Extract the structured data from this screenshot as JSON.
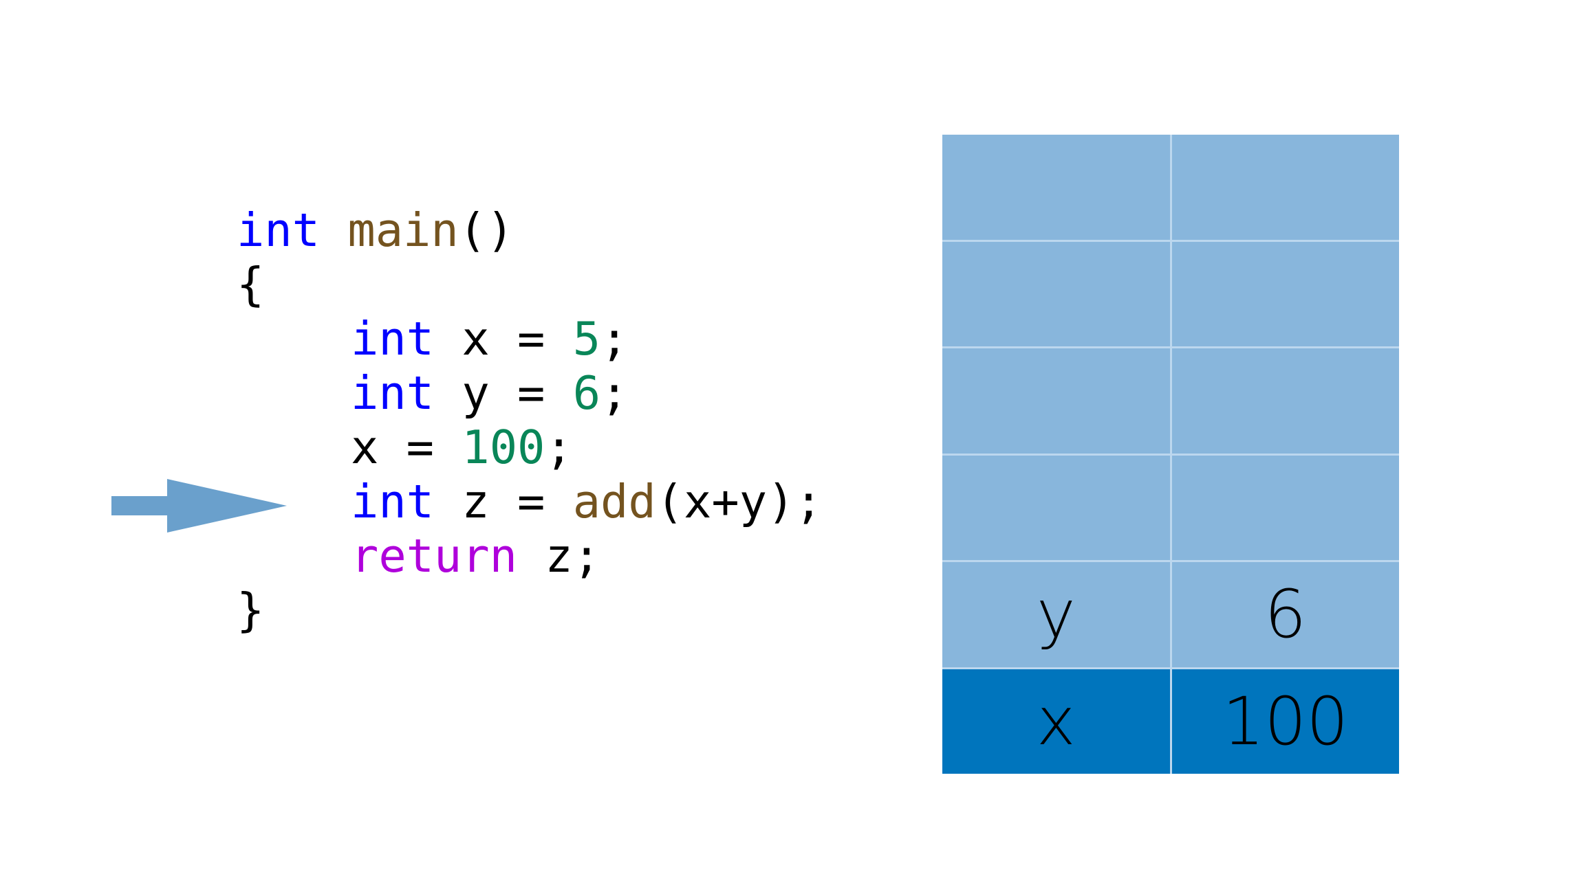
{
  "code": {
    "lines": [
      [
        {
          "t": "int",
          "c": "kw"
        },
        {
          "t": " "
        },
        {
          "t": "main",
          "c": "fn"
        },
        {
          "t": "()"
        }
      ],
      [
        {
          "t": "{"
        }
      ],
      [
        {
          "t": "int",
          "c": "kw"
        },
        {
          "t": " x = "
        },
        {
          "t": "5",
          "c": "num"
        },
        {
          "t": ";"
        }
      ],
      [
        {
          "t": "int",
          "c": "kw"
        },
        {
          "t": " y = "
        },
        {
          "t": "6",
          "c": "num"
        },
        {
          "t": ";"
        }
      ],
      [
        {
          "t": "x = "
        },
        {
          "t": "100",
          "c": "num"
        },
        {
          "t": ";"
        }
      ],
      [
        {
          "t": "int",
          "c": "kw"
        },
        {
          "t": " z = "
        },
        {
          "t": "add",
          "c": "fn"
        },
        {
          "t": "(x+y);"
        }
      ],
      [
        {
          "t": "return",
          "c": "ret"
        },
        {
          "t": " z;"
        }
      ],
      [
        {
          "t": "}"
        }
      ]
    ],
    "indented": [
      false,
      false,
      true,
      true,
      true,
      true,
      true,
      false
    ],
    "current_line_index": 5
  },
  "arrow": {
    "icon": "right-arrow-icon",
    "color": "#6aa0cc",
    "points_to_line": 5
  },
  "memory": {
    "colors": {
      "empty": "#88b6dc",
      "active": "#0075bd",
      "grid_line": "#bcd7ee"
    },
    "rows": [
      {
        "name": "",
        "value": "",
        "active": false
      },
      {
        "name": "",
        "value": "",
        "active": false
      },
      {
        "name": "",
        "value": "",
        "active": false
      },
      {
        "name": "",
        "value": "",
        "active": false
      },
      {
        "name": "y",
        "value": "6",
        "active": false
      },
      {
        "name": "x",
        "value": "100",
        "active": true
      }
    ]
  }
}
